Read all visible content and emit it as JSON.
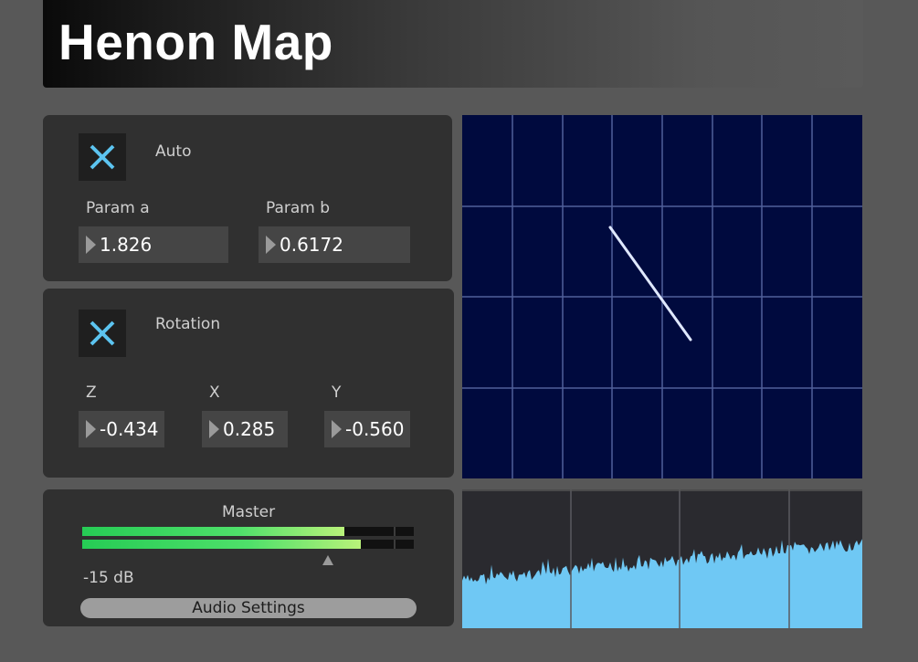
{
  "app": {
    "title": "Henon Map"
  },
  "auto_panel": {
    "toggle_label": "Auto",
    "toggle_on": true,
    "param_a": {
      "label": "Param a",
      "value": "1.826"
    },
    "param_b": {
      "label": "Param b",
      "value": "0.6172"
    }
  },
  "rotation_panel": {
    "toggle_label": "Rotation",
    "toggle_on": true,
    "z": {
      "label": "Z",
      "value": "-0.434"
    },
    "x": {
      "label": "X",
      "value": "0.285"
    },
    "y": {
      "label": "Y",
      "value": "-0.560"
    }
  },
  "master_panel": {
    "label": "Master",
    "gain_label": "-15 dB",
    "meter_left_level": 0.79,
    "meter_right_level": 0.84,
    "audio_settings_label": "Audio Settings"
  },
  "colors": {
    "accent": "#5cc4f0",
    "scope_bg": "#000a3e",
    "spectrum_fill": "#6fc8f4",
    "meter_green": "#3ee060"
  }
}
